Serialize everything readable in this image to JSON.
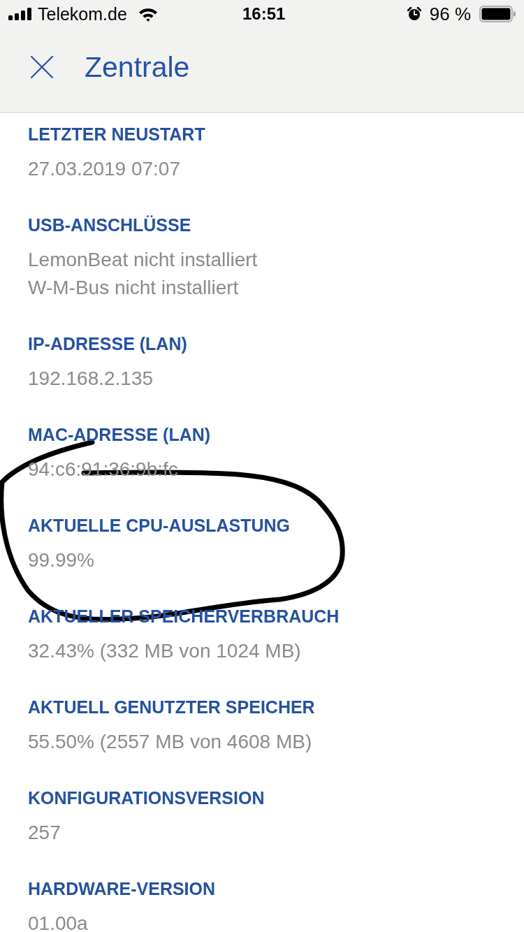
{
  "status_bar": {
    "carrier": "Telekom.de",
    "time": "16:51",
    "battery": "96 %"
  },
  "header": {
    "title": "Zentrale"
  },
  "sections": [
    {
      "label": "LETZTER NEUSTART",
      "values": [
        "27.03.2019 07:07"
      ]
    },
    {
      "label": "USB-ANSCHLÜSSE",
      "values": [
        "LemonBeat nicht installiert",
        "W-M-Bus nicht installiert"
      ]
    },
    {
      "label": "IP-ADRESSE (LAN)",
      "values": [
        "192.168.2.135"
      ]
    },
    {
      "label": "MAC-ADRESSE (LAN)",
      "values": [
        "94:c6:91:36:9b:fc"
      ]
    },
    {
      "label": "AKTUELLE CPU-AUSLASTUNG",
      "values": [
        "99.99%"
      ]
    },
    {
      "label": "AKTUELLER SPEICHERVERBRAUCH",
      "values": [
        "32.43% (332 MB von 1024 MB)"
      ]
    },
    {
      "label": "AKTUELL GENUTZTER SPEICHER",
      "values": [
        "55.50% (2557 MB von 4608 MB)"
      ]
    },
    {
      "label": "KONFIGURATIONSVERSION",
      "values": [
        "257"
      ]
    },
    {
      "label": "HARDWARE-VERSION",
      "values": [
        "01.00a"
      ]
    }
  ]
}
